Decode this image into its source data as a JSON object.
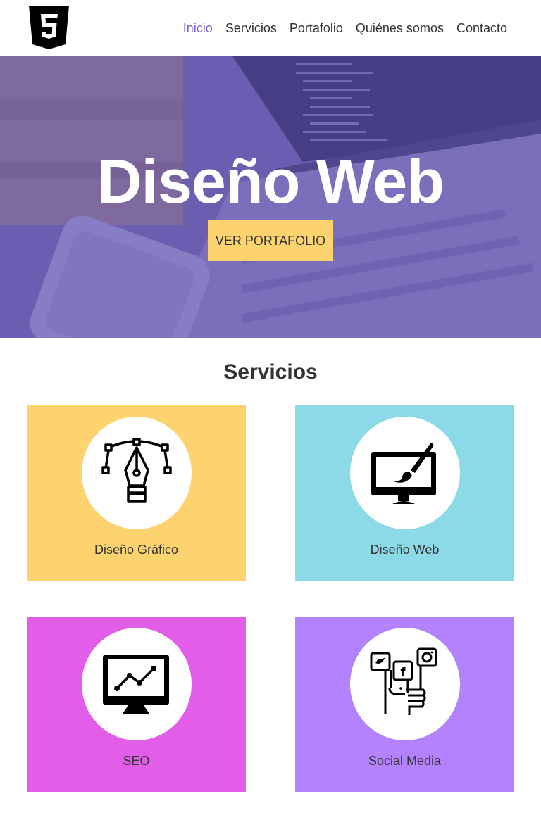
{
  "header": {
    "logo_icon": "html5-shield-icon",
    "nav": [
      {
        "label": "Inicio",
        "active": true
      },
      {
        "label": "Servicios",
        "active": false
      },
      {
        "label": "Portafolio",
        "active": false
      },
      {
        "label": "Quiénes somos",
        "active": false
      },
      {
        "label": "Contacto",
        "active": false
      }
    ],
    "active_color": "#7a5cd1"
  },
  "hero": {
    "title": "Diseño Web",
    "button_label": "VER PORTAFOLIO",
    "overlay_color": "#5f50be",
    "button_color": "#fdd36f"
  },
  "services": {
    "title": "Servicios",
    "cards": [
      {
        "label": "Diseño Gráfico",
        "icon": "pen-tool-icon",
        "color": "#fdd36f"
      },
      {
        "label": "Diseño Web",
        "icon": "monitor-brush-icon",
        "color": "#8cd9e8"
      },
      {
        "label": "SEO",
        "icon": "monitor-chart-icon",
        "color": "#e35ee8"
      },
      {
        "label": "Social Media",
        "icon": "social-media-hand-icon",
        "color": "#b383fd"
      }
    ]
  }
}
